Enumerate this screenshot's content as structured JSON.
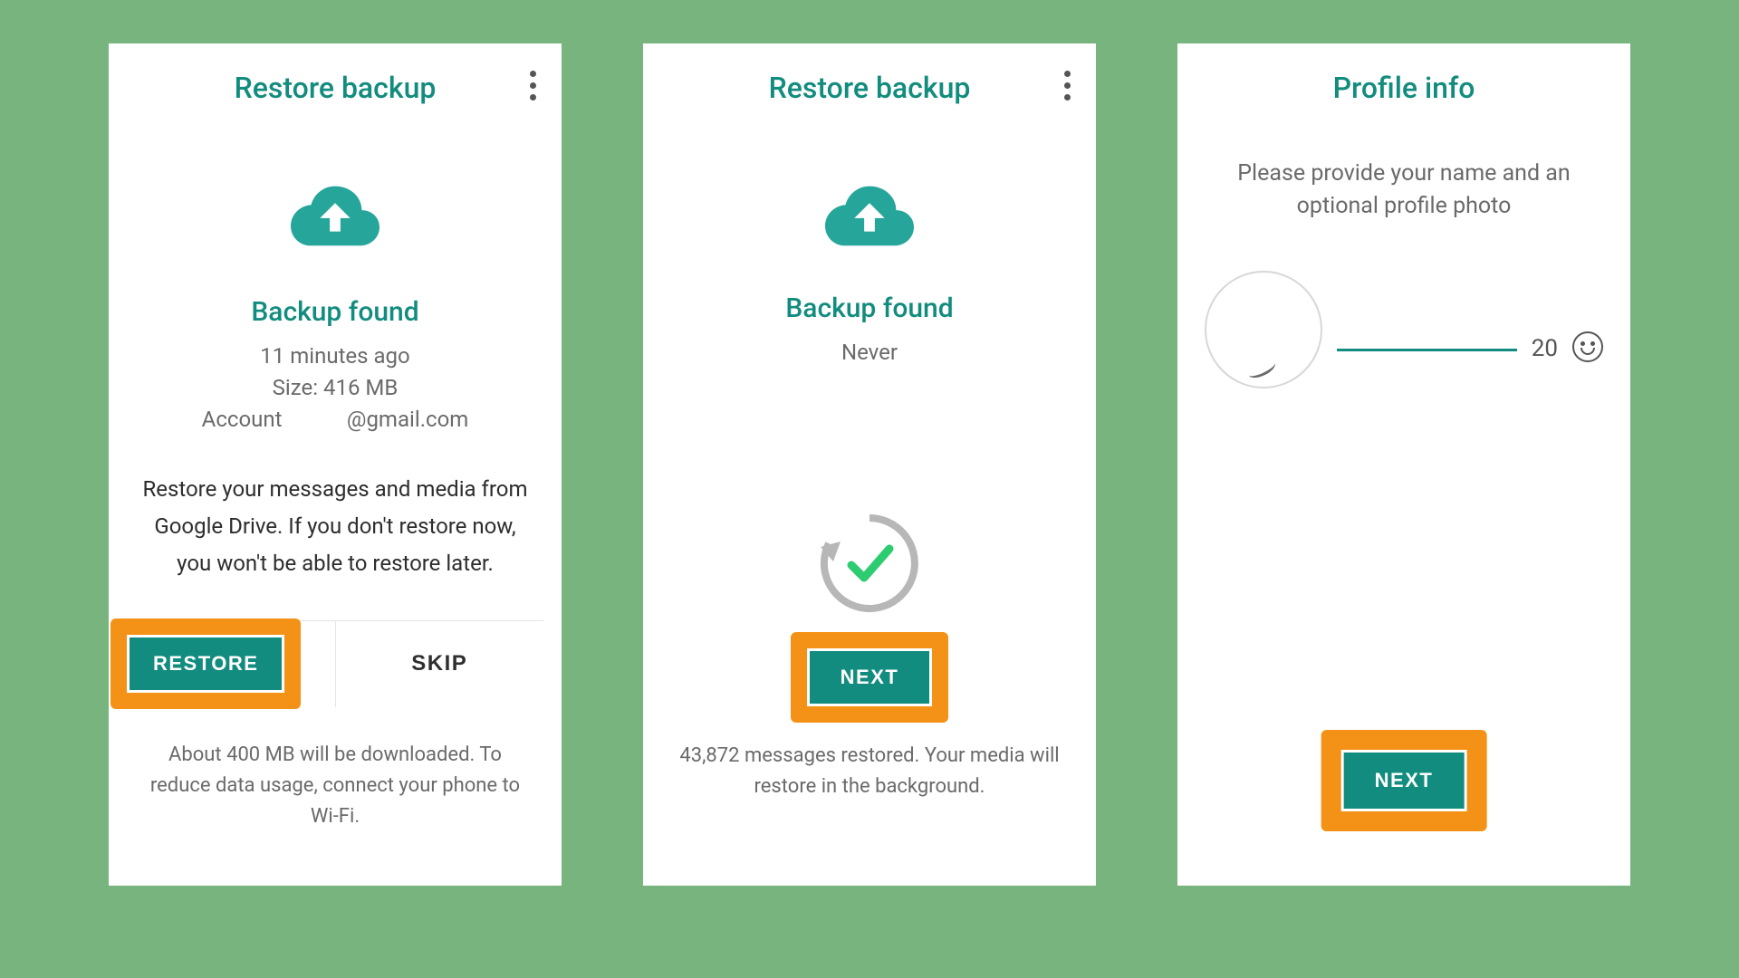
{
  "colors": {
    "primary": "#128c7e",
    "highlight": "#f39217",
    "bg": "#78b47d"
  },
  "screen1": {
    "title": "Restore backup",
    "backup_found": "Backup found",
    "meta_time": "11 minutes ago",
    "meta_size": "Size: 416 MB",
    "meta_account": "Account            @gmail.com",
    "description": "Restore your messages and media from Google Drive. If you don't restore now, you won't be able to restore later.",
    "restore_label": "RESTORE",
    "skip_label": "SKIP",
    "footnote": "About 400 MB will be downloaded. To reduce data usage, connect your phone to Wi-Fi."
  },
  "screen2": {
    "title": "Restore backup",
    "backup_found": "Backup found",
    "meta": "Never",
    "next_label": "NEXT",
    "footnote": "43,872 messages restored. Your media will restore in the background."
  },
  "screen3": {
    "title": "Profile info",
    "subtitle": "Please provide your name and an optional profile photo",
    "char_count": "20",
    "next_label": "NEXT"
  }
}
